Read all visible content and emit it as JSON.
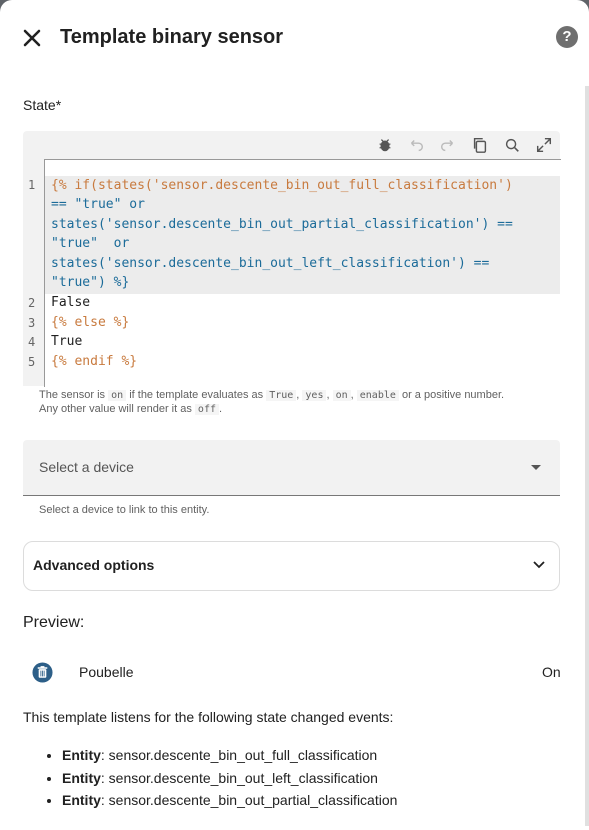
{
  "header": {
    "title": "Template binary sensor",
    "close_icon": "close-icon",
    "help_icon": "help-circle-icon",
    "help_glyph": "?"
  },
  "state_field": {
    "label": "State*"
  },
  "editor": {
    "toolbar": [
      "debug-icon",
      "undo-icon",
      "redo-icon",
      "copy-icon",
      "search-replace-icon",
      "fullscreen-icon"
    ],
    "line_numbers": [
      "1",
      "2",
      "3",
      "4",
      "5"
    ],
    "lines": {
      "l1": "{% if(states('sensor.descente_bin_out_full_classification')",
      "l1b": "== \"true\" or",
      "l1c": "states('sensor.descente_bin_out_partial_classification') ==",
      "l1d": "\"true\"  or",
      "l1e": "states('sensor.descente_bin_out_left_classification') ==",
      "l1f": "\"true\") %}",
      "l2": "False",
      "l3": "{% else %}",
      "l4": "True",
      "l5": "{% endif %}"
    }
  },
  "helper": {
    "p1": "The sensor is",
    "on": "on",
    "p2": "if the template evaluates as",
    "true": "True",
    "c1": ",",
    "yes": "yes",
    "c2": ",",
    "on2": "on",
    "c3": ",",
    "enable": "enable",
    "p3": "or a positive number.",
    "p4": "Any other value will render it as",
    "off": "off",
    "p5": "."
  },
  "device": {
    "placeholder": "Select a device",
    "helper": "Select a device to link to this entity."
  },
  "advanced": {
    "label": "Advanced options"
  },
  "preview": {
    "heading": "Preview:",
    "entity_icon": "trash-can-icon",
    "entity_name": "Poubelle",
    "entity_state": "On",
    "listen_text": "This template listens for the following state changed events:",
    "events": [
      {
        "label": "Entity",
        "value": ": sensor.descente_bin_out_full_classification"
      },
      {
        "label": "Entity",
        "value": ": sensor.descente_bin_out_left_classification"
      },
      {
        "label": "Entity",
        "value": ": sensor.descente_bin_out_partial_classification"
      }
    ]
  },
  "colors": {
    "accent": "#1b6b99",
    "template_tag": "#c87a3e",
    "keyword": "#7a3e9d"
  }
}
